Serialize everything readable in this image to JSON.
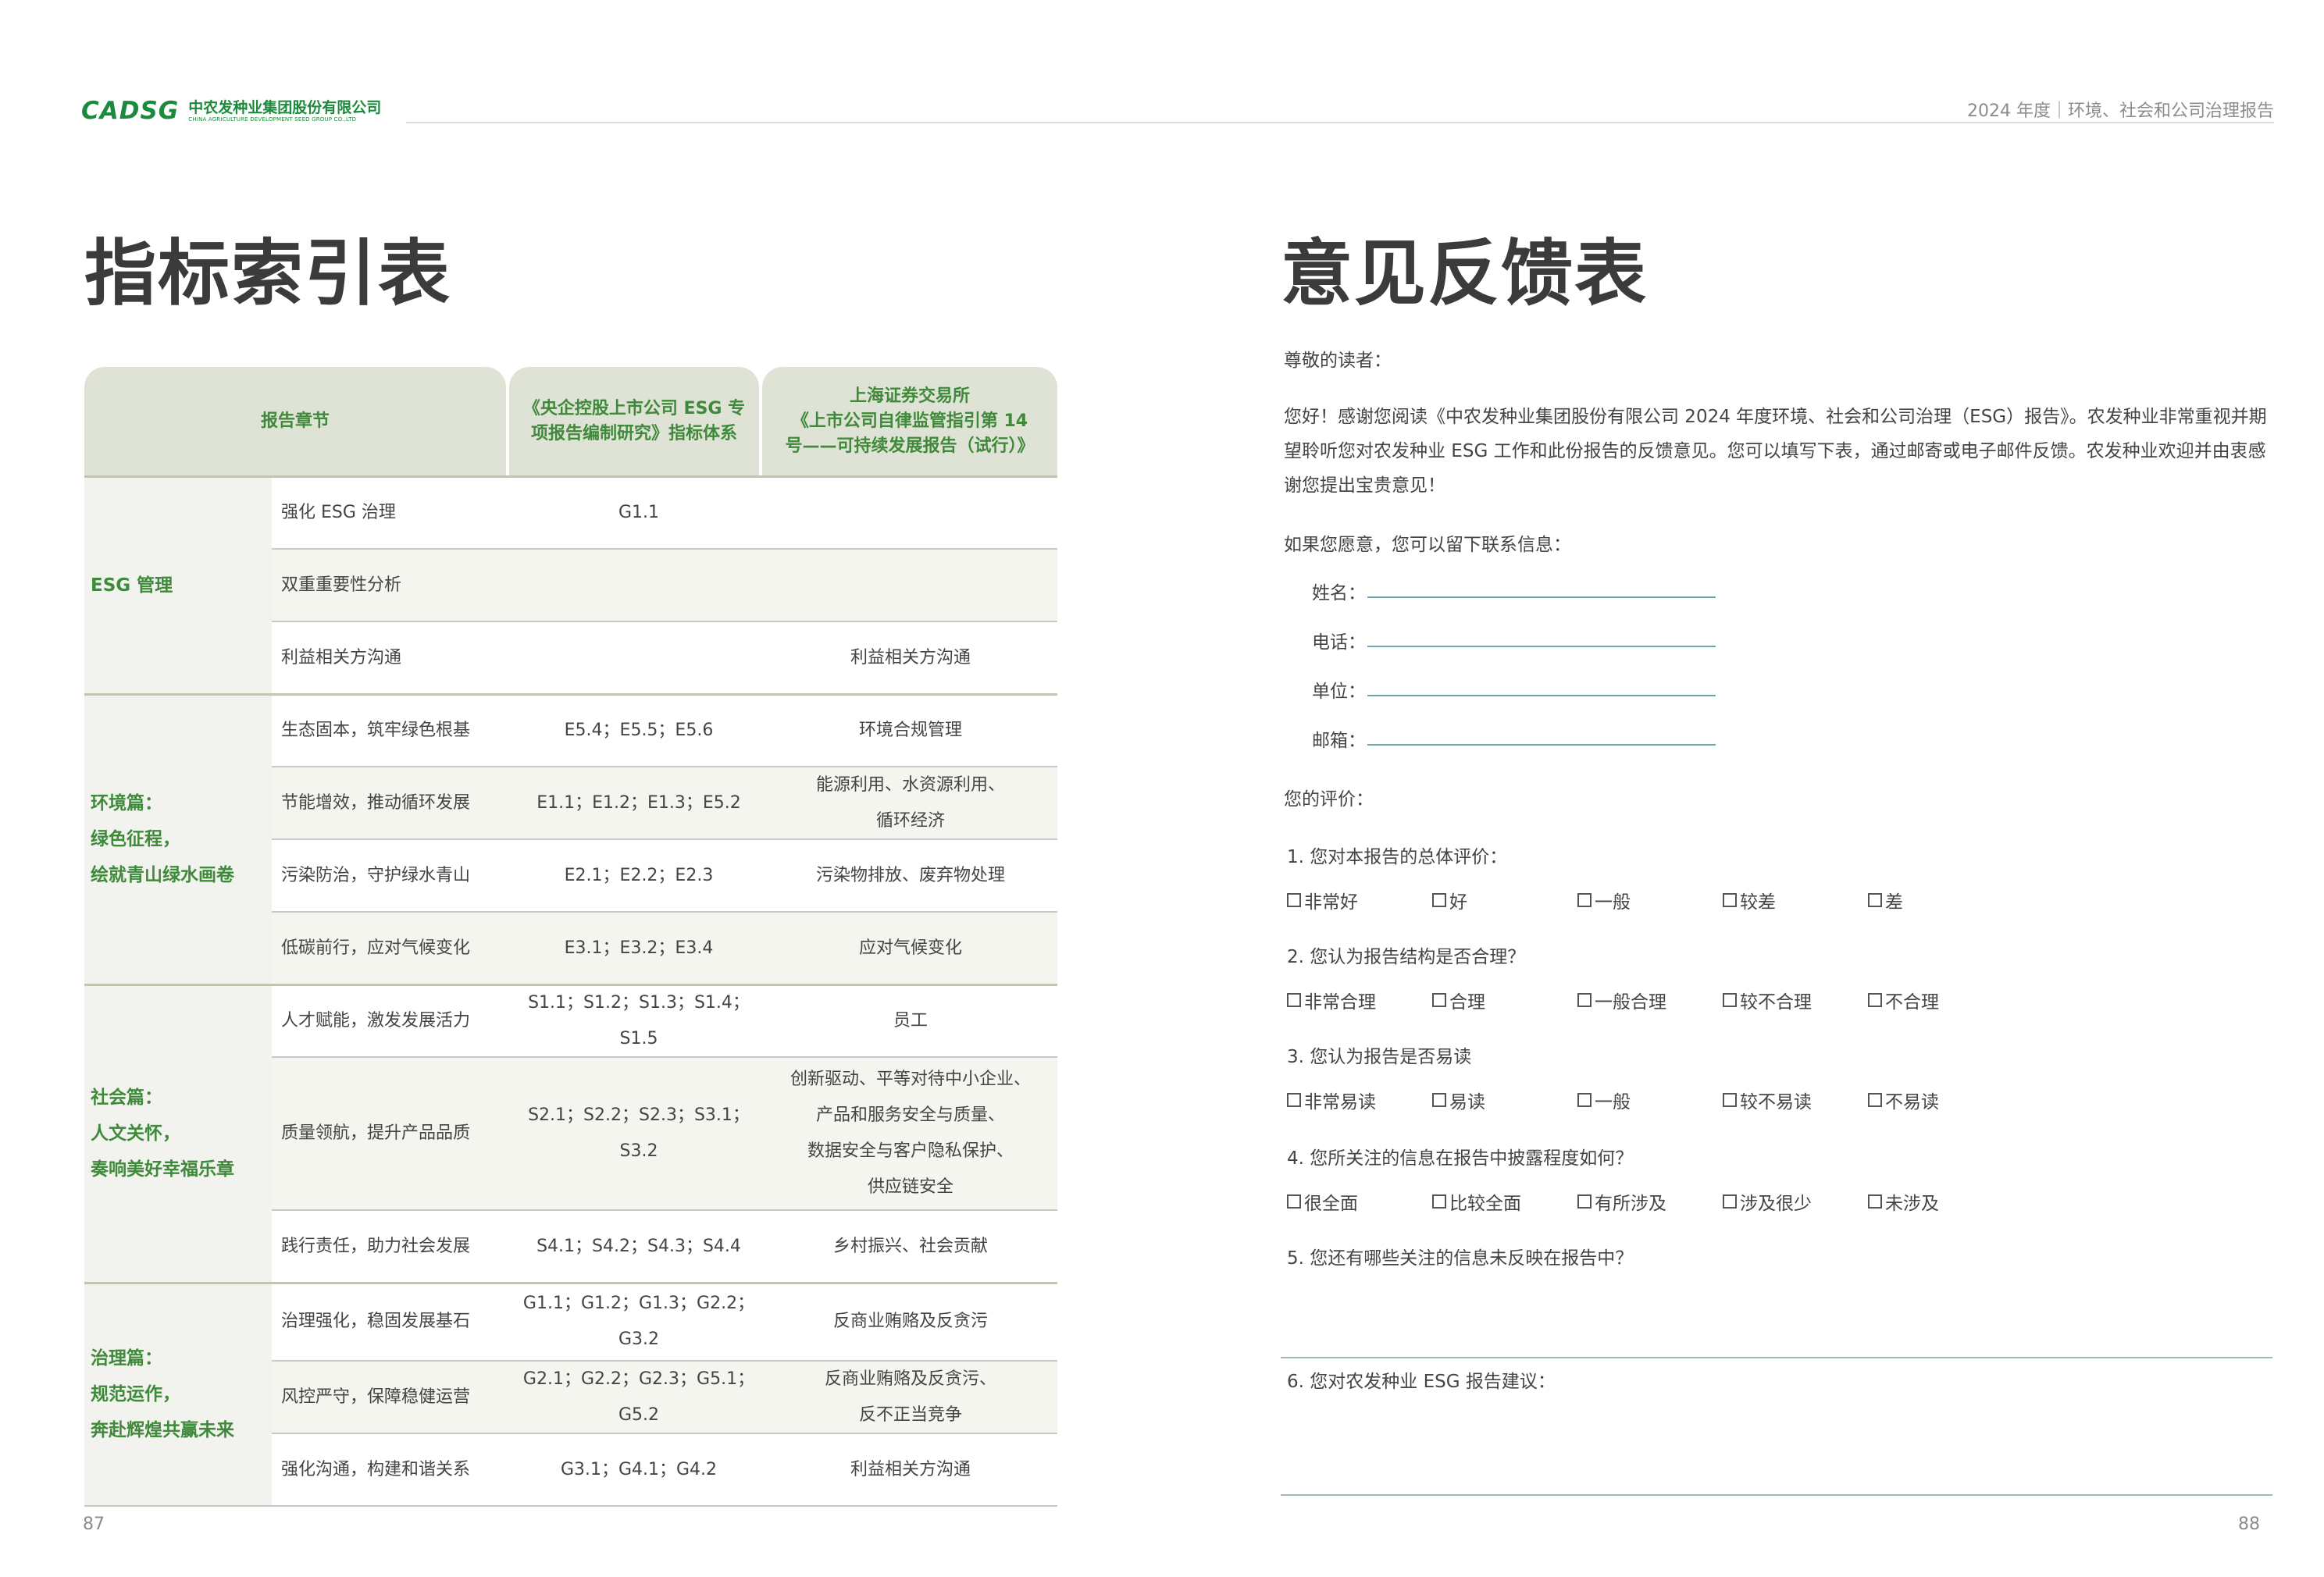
{
  "header": {
    "logo_mark": "CADSG",
    "company_cn": "中农发种业集团股份有限公司",
    "company_en": "CHINA AGRICULTURE DEVELOPMENT SEED GROUP CO.,LTD",
    "report_title": "2024 年度｜环境、社会和公司治理报告"
  },
  "left": {
    "title": "指标索引表",
    "page_number": "87",
    "table": {
      "headers": [
        "报告章节",
        "《央企控股上市公司 ESG 专项报告编制研究》指标体系",
        "上海证券交易所《上市公司自律监管指引第 14 号——可持续发展报告（试行）》"
      ],
      "header3_lines": [
        "上海证券交易所",
        "《上市公司自律监管指引第 14",
        "号——可持续发展报告（试行）》"
      ],
      "header2_lines": [
        "《央企控股上市公司 ESG 专",
        "项报告编制研究》指标体系"
      ],
      "sections": [
        {
          "label_lines": [
            "ESG 管理"
          ],
          "rows": [
            {
              "chapter": "强化 ESG 治理",
              "sasac": "G1.1",
              "sse": ""
            },
            {
              "chapter": "双重重要性分析",
              "sasac": "",
              "sse": ""
            },
            {
              "chapter": "利益相关方沟通",
              "sasac": "",
              "sse": "利益相关方沟通"
            }
          ]
        },
        {
          "label_lines": [
            "环境篇：",
            "绿色征程，",
            "绘就青山绿水画卷"
          ],
          "rows": [
            {
              "chapter": "生态固本，筑牢绿色根基",
              "sasac": "E5.4；E5.5；E5.6",
              "sse": "环境合规管理"
            },
            {
              "chapter": "节能增效，推动循环发展",
              "sasac": "E1.1；E1.2；E1.3；E5.2",
              "sse": "能源利用、水资源利用、\n循环经济"
            },
            {
              "chapter": "污染防治，守护绿水青山",
              "sasac": "E2.1；E2.2；E2.3",
              "sse": "污染物排放、废弃物处理"
            },
            {
              "chapter": "低碳前行，应对气候变化",
              "sasac": "E3.1；E3.2；E3.4",
              "sse": "应对气候变化"
            }
          ]
        },
        {
          "label_lines": [
            "社会篇：",
            "人文关怀，",
            "奏响美好幸福乐章"
          ],
          "rows": [
            {
              "chapter": "人才赋能，激发发展活力",
              "sasac": "S1.1；S1.2；S1.3；S1.4；\nS1.5",
              "sse": "员工"
            },
            {
              "chapter": "质量领航，提升产品品质",
              "sasac": "S2.1；S2.2；S2.3；S3.1；\nS3.2",
              "sse": "创新驱动、平等对待中小企业、\n产品和服务安全与质量、\n数据安全与客户隐私保护、\n供应链安全"
            },
            {
              "chapter": "践行责任，助力社会发展",
              "sasac": "S4.1；S4.2；S4.3；S4.4",
              "sse": "乡村振兴、社会贡献"
            }
          ]
        },
        {
          "label_lines": [
            "治理篇：",
            "规范运作，",
            "奔赴辉煌共赢未来"
          ],
          "rows": [
            {
              "chapter": "治理强化，稳固发展基石",
              "sasac": "G1.1；G1.2；G1.3；G2.2；\nG3.2",
              "sse": "反商业贿赂及反贪污"
            },
            {
              "chapter": "风控严守，保障稳健运营",
              "sasac": "G2.1；G2.2；G2.3；G5.1；\nG5.2",
              "sse": "反商业贿赂及反贪污、\n反不正当竞争"
            },
            {
              "chapter": "强化沟通，构建和谐关系",
              "sasac": "G3.1；G4.1；G4.2",
              "sse": "利益相关方沟通"
            }
          ]
        }
      ]
    }
  },
  "right": {
    "title": "意见反馈表",
    "page_number": "88",
    "salutation": "尊敬的读者：",
    "intro": "您好！感谢您阅读《中农发种业集团股份有限公司 2024 年度环境、社会和公司治理（ESG）报告》。农发种业非常重视并期望聆听您对农发种业 ESG 工作和此份报告的反馈意见。您可以填写下表，通过邮寄或电子邮件反馈。农发种业欢迎并由衷感谢您提出宝贵意见！",
    "contact_intro": "如果您愿意，您可以留下联系信息：",
    "fields": [
      "姓名：",
      "电话：",
      "单位：",
      "邮箱："
    ],
    "eval_label": "您的评价：",
    "questions": [
      {
        "text": "1. 您对本报告的总体评价：",
        "options": [
          "非常好",
          "好",
          "一般",
          "较差",
          "差"
        ]
      },
      {
        "text": "2. 您认为报告结构是否合理？",
        "options": [
          "非常合理",
          "合理",
          "一般合理",
          "较不合理",
          "不合理"
        ]
      },
      {
        "text": "3. 您认为报告是否易读",
        "options": [
          "非常易读",
          "易读",
          "一般",
          "较不易读",
          "不易读"
        ]
      },
      {
        "text": "4. 您所关注的信息在报告中披露程度如何？",
        "options": [
          "很全面",
          "比较全面",
          "有所涉及",
          "涉及很少",
          "未涉及"
        ]
      },
      {
        "text": "5. 您还有哪些关注的信息未反映在报告中？",
        "options": []
      },
      {
        "text": "6. 您对农发种业 ESG 报告建议：",
        "options": []
      }
    ]
  }
}
